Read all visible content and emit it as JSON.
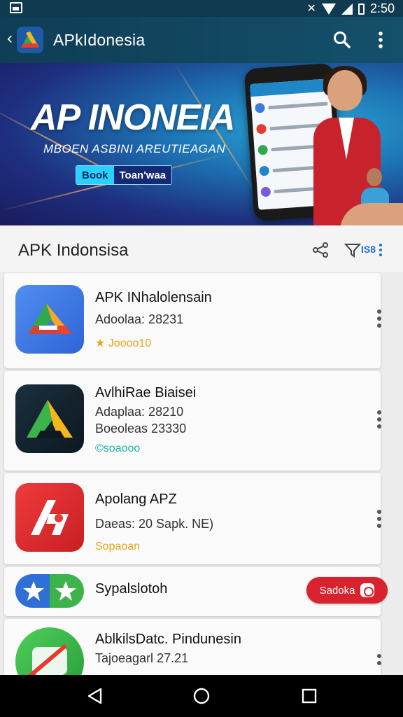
{
  "status_bar": {
    "time": "2:50",
    "icons": [
      "gallery-icon",
      "mute-icon",
      "wifi-icon",
      "signal-icon",
      "battery-icon"
    ]
  },
  "app_bar": {
    "title": "APkIdonesia",
    "icons": [
      "back-icon",
      "app-logo",
      "search-icon",
      "more-vert-icon"
    ]
  },
  "banner": {
    "headline": "AP INONEIA",
    "subline": "MBOEN ASBINI AREUTIEAGAN",
    "cta_left": "Book",
    "cta_right": "Toan'waa"
  },
  "section": {
    "title": "APK Indonsisa",
    "icons": [
      "share-icon",
      "filter-icon",
      "more-icon"
    ],
    "filter_badge": "IS8"
  },
  "apps": [
    {
      "name": "APK INhalolensain",
      "meta1": "Adoolaa: 28231",
      "meta2": "",
      "rating": "★ Joooo10",
      "rating_color": "#e8a317"
    },
    {
      "name": "AvlhiRae Biaisei",
      "meta1": "Adaplaa: 28210",
      "meta2": "Boeoleas 23330",
      "rating": "©soaooo",
      "rating_color": "#1bb3a8"
    },
    {
      "name": "Apolang APZ",
      "meta1": "Daeas: 20 Sapk. NE)",
      "meta2": "",
      "rating": "Sopaoan",
      "rating_color": "#e8a317"
    },
    {
      "name": "Sypalslotoh",
      "meta1": "",
      "meta2": "",
      "rating": "",
      "rating_color": "",
      "button": "Sadoka"
    },
    {
      "name": "AblkilsDatc. Pindunesin",
      "meta1": "Tajoeagarl 27.21",
      "meta2": "",
      "rating": "",
      "rating_color": ""
    }
  ],
  "nav_bar": {
    "icons": [
      "back-triangle-icon",
      "home-circle-icon",
      "recents-square-icon"
    ]
  }
}
